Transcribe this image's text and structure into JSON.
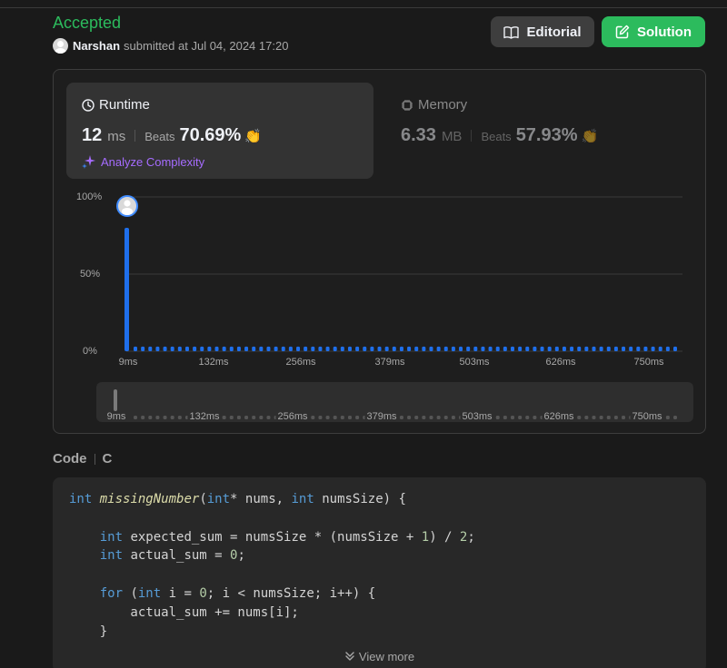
{
  "submission": {
    "status": "Accepted",
    "user": "Narshan",
    "submitted_text": "submitted at Jul 04, 2024 17:20"
  },
  "buttons": {
    "editorial": "Editorial",
    "solution": "Solution"
  },
  "runtime": {
    "title": "Runtime",
    "value": "12",
    "unit": "ms",
    "beats_label": "Beats",
    "beats_value": "70.69%",
    "analyze_label": "Analyze Complexity"
  },
  "memory": {
    "title": "Memory",
    "value": "6.33",
    "unit": "MB",
    "beats_label": "Beats",
    "beats_value": "57.93%"
  },
  "chart_data": {
    "type": "bar",
    "y_ticks": [
      "100%",
      "50%",
      "0%"
    ],
    "x_ticks": [
      "9ms",
      "132ms",
      "256ms",
      "379ms",
      "503ms",
      "626ms",
      "750ms"
    ],
    "ylim": [
      0,
      100
    ],
    "xlim": [
      9,
      750
    ],
    "highlight_value": 80,
    "baseline_bar_count": 74,
    "baseline_value": 3,
    "grid": true,
    "colors": {
      "bar": "#1f6feb",
      "grid": "#3a3a3a"
    }
  },
  "code_section": {
    "label": "Code",
    "language": "C",
    "view_more": "View more"
  },
  "colors": {
    "accent_green": "#2cbb5d",
    "purple": "#a66cff"
  }
}
